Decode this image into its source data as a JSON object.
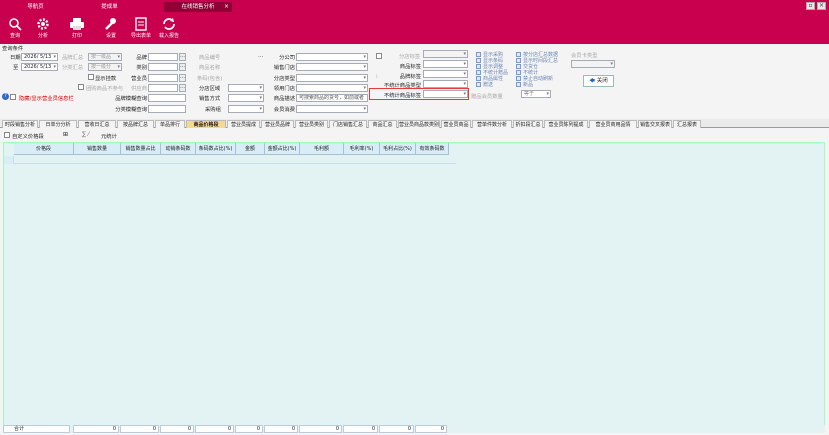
{
  "window_tabs": [
    {
      "label": "导航页",
      "active": false
    },
    {
      "label": "提成单",
      "active": false
    },
    {
      "label": "在线销售分析",
      "active": true
    }
  ],
  "window_close": "×",
  "toolbar": [
    {
      "label": "查询",
      "icon": "search-icon"
    },
    {
      "label": "分析",
      "icon": "gear-icon"
    },
    {
      "label": "打印",
      "icon": "printer-icon"
    },
    {
      "label": "设置",
      "icon": "wrench-icon"
    },
    {
      "label": "导出表单",
      "icon": "export-icon"
    },
    {
      "label": "载入报告",
      "icon": "refresh-icon"
    }
  ],
  "query": {
    "section_title": "查询条件",
    "date_label": "日期",
    "date_from": "2026/ 5/13",
    "to_label": "至",
    "date_to": "2026/ 5/13",
    "brand_pt1_label": "品牌汇总",
    "brand_pt1_value": "按一级品",
    "brand_pt2_label": "分类汇总",
    "brand_pt2_value": "按一级分",
    "show_hidden_label": "显示挂款",
    "exclude_gift_label": "团购商品不参与",
    "brand_label": "品牌",
    "category_label": "类别",
    "sales_rep_label": "营业员",
    "supplier_label": "供应商",
    "brand_fuzzy_label": "品牌模糊查询",
    "category_fuzzy_label": "分类模糊查询",
    "product_code_label": "商品编号",
    "product_name_label": "商品名称",
    "product_spec_label": "条码(包含)",
    "store_area_label": "分店区域",
    "sales_method_label": "销售方式",
    "channel_label": "采购组",
    "branch_label": "分公司",
    "sales_store_label": "销售门店",
    "store_type_label": "分店类型",
    "inventory_store_label": "领用门店",
    "product_desc_label": "商品描述",
    "product_desc_placeholder": "可搜索商品的货号，如前或者",
    "member_channel_label": "会员消费",
    "store_tag_label": "分店标签",
    "store_tag_value": "",
    "product_tag_label": "商品标签",
    "product_tag_label2": "品牌标签",
    "exclude_type_label": "不统计商品类型",
    "exclude_tag_label": "不统计商品标签",
    "gift_count_label": "赠品会员数量",
    "gift_count_op": "等于",
    "member_type_label": "会员卡类型",
    "hide_member_text": "隐藏/显示营业员信息栏",
    "checks": [
      "显示采购",
      "显示条码",
      "显示调整",
      "不统计赠品",
      "商品属性",
      "赠送",
      "按分店汇总数据",
      "显示时间段汇总",
      "交货仓",
      "不统计",
      "禁止自动刷新",
      "新品"
    ],
    "close_label": "关闭"
  },
  "report_tabs": [
    "时段销售分析",
    "日单分分析",
    "营收日汇总",
    "按品牌汇总",
    "单品排行",
    "商品价格段",
    "营业员提成",
    "营业员品牌",
    "营业员类别",
    "门店销售汇总",
    "商品汇总",
    "营业员商品款类别",
    "营业员商品",
    "营单件数分析",
    "折扣段汇总",
    "营业员陈列提成",
    "营业员商用品情",
    "销售交叉报表",
    "汇总报表"
  ],
  "active_report_tab": 5,
  "grid_tools": {
    "custom_label": "自定义价格段",
    "summary_label": "元统计"
  },
  "columns": [
    "价格段",
    "销售数量",
    "销售数量占比",
    "动销条码数",
    "条码数占比(%)",
    "金额",
    "金额占比(%)",
    "毛利额",
    "毛利率(%)",
    "毛利占比(%)",
    "有效条码数"
  ],
  "totals": {
    "label": "合计",
    "values": [
      "0",
      "0",
      "0",
      "0",
      "0",
      "0",
      "0",
      "0",
      "0",
      "0"
    ]
  }
}
